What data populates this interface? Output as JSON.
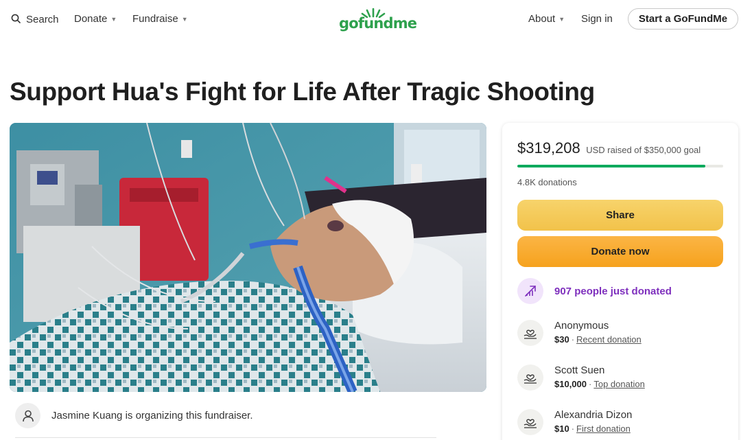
{
  "header": {
    "search_label": "Search",
    "donate_label": "Donate",
    "fundraise_label": "Fundraise",
    "logo_text": "gofundme",
    "about_label": "About",
    "signin_label": "Sign in",
    "start_label": "Start a GoFundMe"
  },
  "campaign": {
    "title": "Support Hua's Fight for Life After Tragic Shooting",
    "organizer_text": "Jasmine Kuang is organizing this fundraiser."
  },
  "card": {
    "raised_amount": "$319,208",
    "raised_rest": "USD raised of $350,000 goal",
    "progress_fraction": 0.912,
    "donation_count": "4.8K donations",
    "share_label": "Share",
    "donate_label": "Donate now",
    "just_donated": "907 people just donated",
    "donors": [
      {
        "name": "Anonymous",
        "amount": "$30",
        "tag": "Recent donation"
      },
      {
        "name": "Scott Suen",
        "amount": "$10,000",
        "tag": "Top donation"
      },
      {
        "name": "Alexandria Dizon",
        "amount": "$10",
        "tag": "First donation"
      }
    ]
  },
  "colors": {
    "brand_green": "#02a95c",
    "share_yellow": "#f2c24a",
    "donate_orange": "#f6a21d",
    "accent_purple": "#7e2fbd"
  },
  "icons": [
    "search-icon",
    "chevron-down-icon",
    "logo-sun-icon",
    "person-icon",
    "trend-up-icon",
    "hand-heart-icon"
  ]
}
